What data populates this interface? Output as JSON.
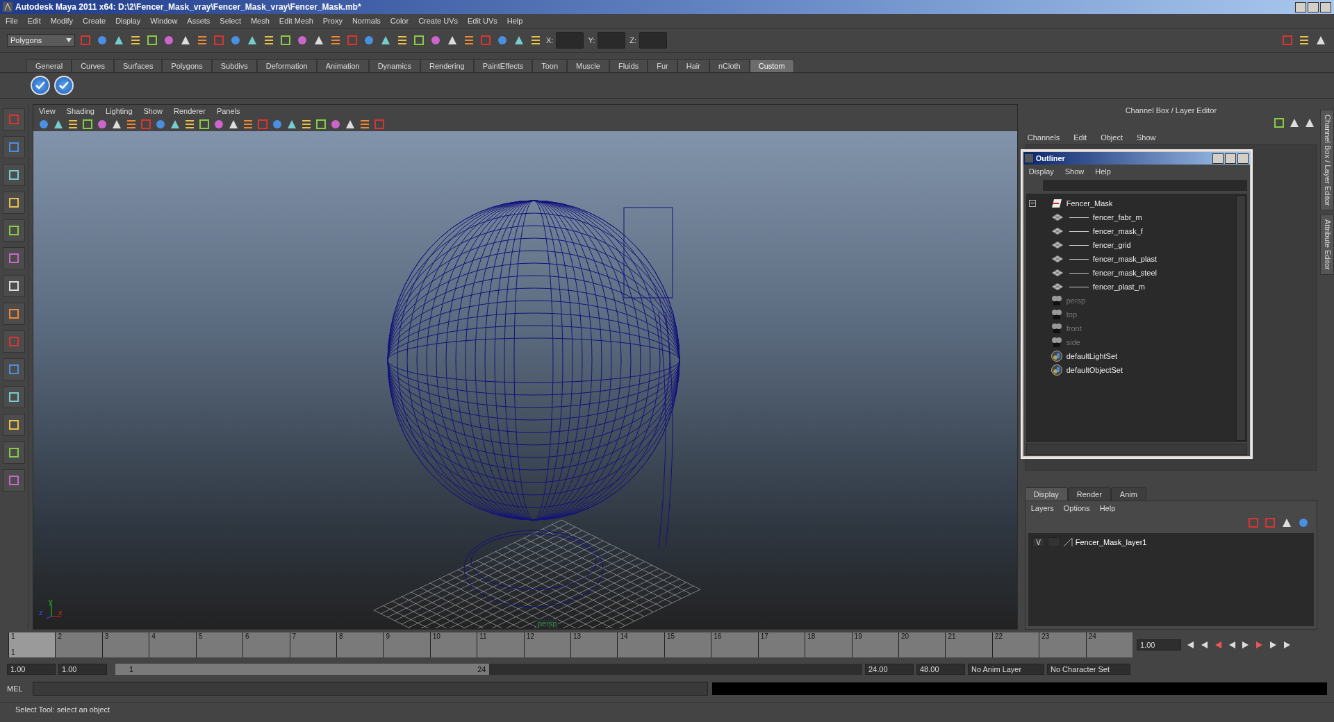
{
  "window": {
    "title": "Autodesk Maya 2011 x64: D:\\2\\Fencer_Mask_vray\\Fencer_Mask_vray\\Fencer_Mask.mb*"
  },
  "menu_bar": [
    "File",
    "Edit",
    "Modify",
    "Create",
    "Display",
    "Window",
    "Assets",
    "Select",
    "Mesh",
    "Edit Mesh",
    "Proxy",
    "Normals",
    "Color",
    "Create UVs",
    "Edit UVs",
    "Help"
  ],
  "status_line": {
    "mode": "Polygons",
    "coords": [
      "X:",
      "Y:",
      "Z:"
    ]
  },
  "shelf": {
    "tabs": [
      {
        "label": "General",
        "selected": false
      },
      {
        "label": "Curves",
        "selected": false
      },
      {
        "label": "Surfaces",
        "selected": false
      },
      {
        "label": "Polygons",
        "selected": false
      },
      {
        "label": "Subdivs",
        "selected": false
      },
      {
        "label": "Deformation",
        "selected": false
      },
      {
        "label": "Animation",
        "selected": false
      },
      {
        "label": "Dynamics",
        "selected": false
      },
      {
        "label": "Rendering",
        "selected": false
      },
      {
        "label": "PaintEffects",
        "selected": false
      },
      {
        "label": "Toon",
        "selected": false
      },
      {
        "label": "Muscle",
        "selected": false
      },
      {
        "label": "Fluids",
        "selected": false
      },
      {
        "label": "Fur",
        "selected": false
      },
      {
        "label": "Hair",
        "selected": false
      },
      {
        "label": "nCloth",
        "selected": false
      },
      {
        "label": "Custom",
        "selected": true
      }
    ]
  },
  "viewport": {
    "menus": [
      "View",
      "Shading",
      "Lighting",
      "Show",
      "Renderer",
      "Panels"
    ],
    "axis": [
      "y",
      "z",
      "x"
    ],
    "camera": "persp"
  },
  "channel_box": {
    "title": "Channel Box / Layer Editor",
    "menus": [
      "Channels",
      "Edit",
      "Object",
      "Show"
    ]
  },
  "outliner": {
    "title": "Outliner",
    "menus": [
      "Display",
      "Show",
      "Help"
    ],
    "items": [
      {
        "label": "Fencer_Mask",
        "kind": "transform",
        "dimmed": false,
        "expanded": true,
        "children": [
          {
            "label": "fencer_fabr_m",
            "kind": "mesh",
            "dimmed": false
          },
          {
            "label": "fencer_mask_f",
            "kind": "mesh",
            "dimmed": false
          },
          {
            "label": "fencer_grid",
            "kind": "mesh",
            "dimmed": false
          },
          {
            "label": "fencer_mask_plast",
            "kind": "mesh",
            "dimmed": false
          },
          {
            "label": "fencer_mask_steel",
            "kind": "mesh",
            "dimmed": false
          },
          {
            "label": "fencer_plast_m",
            "kind": "mesh",
            "dimmed": false
          }
        ]
      },
      {
        "label": "persp",
        "kind": "camera",
        "dimmed": true
      },
      {
        "label": "top",
        "kind": "camera",
        "dimmed": true
      },
      {
        "label": "front",
        "kind": "camera",
        "dimmed": true
      },
      {
        "label": "side",
        "kind": "camera",
        "dimmed": true
      },
      {
        "label": "defaultLightSet",
        "kind": "set",
        "dimmed": false
      },
      {
        "label": "defaultObjectSet",
        "kind": "set",
        "dimmed": false
      }
    ]
  },
  "layer_editor": {
    "tabs": [
      {
        "label": "Display",
        "selected": true
      },
      {
        "label": "Render",
        "selected": false
      },
      {
        "label": "Anim",
        "selected": false
      }
    ],
    "menus": [
      "Layers",
      "Options",
      "Help"
    ],
    "layers": [
      {
        "visibility": "V",
        "name": "Fencer_Mask_layer1"
      }
    ]
  },
  "side_tabs": [
    "Channel Box / Layer Editor",
    "Attribute Editor"
  ],
  "time_slider": {
    "ticks": [
      {
        "label": "1",
        "selected": true
      },
      {
        "label": "2",
        "selected": false
      },
      {
        "label": "3",
        "selected": false
      },
      {
        "label": "4",
        "selected": false
      },
      {
        "label": "5",
        "selected": false
      },
      {
        "label": "6",
        "selected": false
      },
      {
        "label": "7",
        "selected": false
      },
      {
        "label": "8",
        "selected": false
      },
      {
        "label": "9",
        "selected": false
      },
      {
        "label": "10",
        "selected": false
      },
      {
        "label": "11",
        "selected": false
      },
      {
        "label": "12",
        "selected": false
      },
      {
        "label": "13",
        "selected": false
      },
      {
        "label": "14",
        "selected": false
      },
      {
        "label": "15",
        "selected": false
      },
      {
        "label": "16",
        "selected": false
      },
      {
        "label": "17",
        "selected": false
      },
      {
        "label": "18",
        "selected": false
      },
      {
        "label": "19",
        "selected": false
      },
      {
        "label": "20",
        "selected": false
      },
      {
        "label": "21",
        "selected": false
      },
      {
        "label": "22",
        "selected": false
      },
      {
        "label": "23",
        "selected": false
      },
      {
        "label": "24",
        "selected": false
      }
    ],
    "current_frame": "1",
    "current_time": "1.00"
  },
  "range_slider": {
    "level": 0.5,
    "start": "1.00",
    "playback_start": "1.00",
    "range_start": "1",
    "range_end": "24",
    "playback_end": "24.00",
    "end": "48.00",
    "anim_layer": "No Anim Layer",
    "character_set": "No Character Set"
  },
  "command_line": {
    "label": "MEL"
  },
  "help_line": "Select Tool: select an object"
}
